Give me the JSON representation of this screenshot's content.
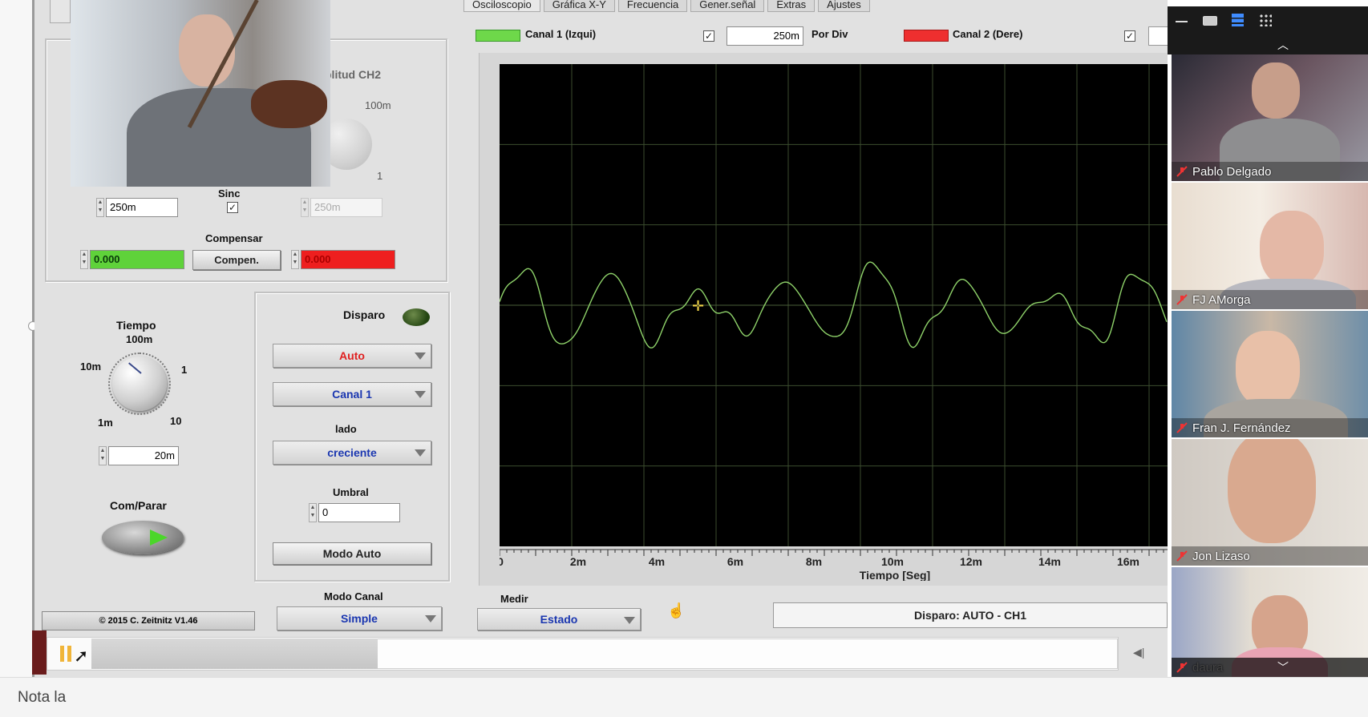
{
  "tabs": [
    "Osciloscopio",
    "Gráfica X-Y",
    "Frecuencia",
    "Gener.señal",
    "Extras",
    "Ajustes"
  ],
  "channel1": {
    "label": "Canal 1 (Izqui)",
    "color": "#6ed84a"
  },
  "channel2": {
    "label": "Canal 2 (Dere)",
    "color": "#ee2f2f"
  },
  "time_per_div": {
    "value": "250m",
    "label": "Por Div"
  },
  "amplitude": {
    "ch2_title": "plitud CH2",
    "ch2_scale_label": "100m",
    "ch2_scale_label2": "1",
    "ch1_value": "250m",
    "sync_label": "Sinc",
    "ch2_value": "250m"
  },
  "offset": {
    "title": "Compensar",
    "ch1_value": "0.000",
    "button": "Compen.",
    "ch2_value": "0.000"
  },
  "time": {
    "title": "Tiempo",
    "labels": [
      "100m",
      "10m",
      "1",
      "1m",
      "10"
    ],
    "value": "20m"
  },
  "start_stop": {
    "label": "Com/Parar"
  },
  "trigger": {
    "title": "Disparo",
    "mode": "Auto",
    "source": "Canal 1",
    "edge_label": "lado",
    "edge": "creciente",
    "threshold_label": "Umbral",
    "threshold_value": "0",
    "auto_button": "Modo Auto"
  },
  "copyright": "© 2015 C. Zeitnitz V1.46",
  "channel_mode": {
    "label": "Modo Canal",
    "value": "Simple"
  },
  "measure": {
    "label": "Medir",
    "value": "Estado"
  },
  "status": "Disparo: AUTO - CH1",
  "plot": {
    "xlabel": "Tiempo [Seg]",
    "ticks": [
      "0",
      "2m",
      "4m",
      "6m",
      "8m",
      "10m",
      "12m",
      "14m",
      "16m"
    ]
  },
  "chart_data": {
    "type": "line",
    "title": "",
    "xlabel": "Tiempo [Seg]",
    "ylabel": "",
    "xlim": [
      0,
      0.017
    ],
    "x_ticks": [
      "0",
      "2m",
      "4m",
      "6m",
      "8m",
      "10m",
      "12m",
      "14m",
      "16m"
    ],
    "grid": true,
    "series": [
      {
        "name": "Canal 1 (Izqui)",
        "color": "#8fd36a",
        "description_values": "oscillating waveform around 0 over 0-17 ms"
      }
    ]
  },
  "participants": [
    "Pablo Delgado",
    "FJ AMorga",
    "Fran J. Fernández",
    "Jon Lizaso",
    "daura"
  ],
  "note": "Nota la"
}
